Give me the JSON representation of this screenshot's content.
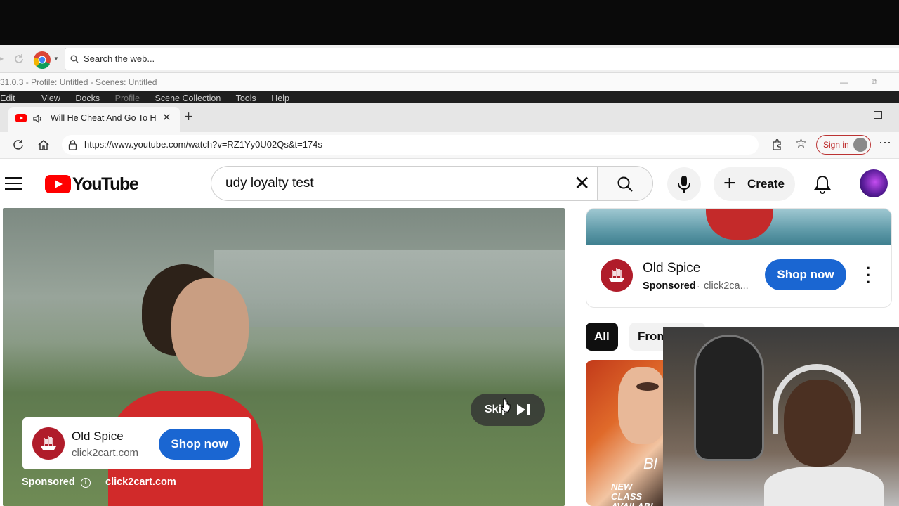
{
  "obs": {
    "search_placeholder": "Search the web...",
    "title": "31.0.3 - Profile: Untitled - Scenes: Untitled",
    "menu": [
      "Edit",
      "View",
      "Docks",
      "Profile",
      "Scene Collection",
      "Tools",
      "Help"
    ]
  },
  "browser": {
    "tab_title": "Will He Cheat And Go To He",
    "url": "https://www.youtube.com/watch?v=RZ1Yy0U02Qs&t=174s",
    "sign_in": "Sign in"
  },
  "youtube": {
    "logo_text": "YouTube",
    "search_query": "udy loyalty test",
    "create_label": "Create",
    "video_ad": {
      "advertiser": "Old Spice",
      "domain": "click2cart.com",
      "cta": "Shop now",
      "skip_label": "Skip",
      "sponsored_label": "Sponsored",
      "footer_domain": "click2cart.com"
    },
    "sidebar_ad": {
      "advertiser": "Old Spice",
      "sponsored_label": "Sponsored",
      "domain_short": "click2ca...",
      "cta": "Shop now"
    },
    "chips": [
      "All",
      "From"
    ],
    "thumbnail_text": "NEW CLASS AVAILABI",
    "thumbnail_logo": "Bl"
  },
  "colors": {
    "youtube_red": "#ff0000",
    "shop_button_blue": "#1a66d2",
    "signin_red": "#b22222"
  }
}
